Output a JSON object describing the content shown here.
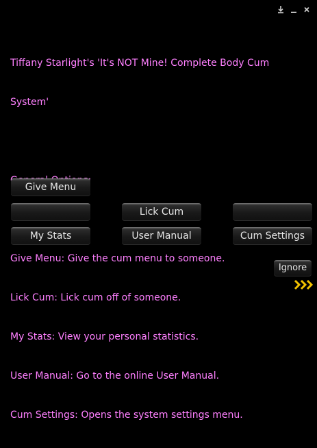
{
  "window": {
    "controls": {
      "download_icon": "⤓",
      "minimize_icon": "–",
      "close_icon": "×"
    }
  },
  "message": {
    "title_line1": "Tiffany Starlight's 'It's NOT Mine! Complete Body Cum",
    "title_line2": "System'",
    "section_heading": "General Options:",
    "options": [
      "Give Menu: Give the cum menu to someone.",
      "Lick Cum: Lick cum off of someone.",
      "My Stats: View your personal statistics.",
      "User Manual: Go to the online User Manual.",
      "Cum Settings: Opens the system settings menu."
    ],
    "color": "#ff80ff"
  },
  "buttons": {
    "give_menu": "Give Menu",
    "blank_left": "",
    "lick_cum": "Lick Cum",
    "blank_right": "",
    "my_stats": "My Stats",
    "user_manual": "User Manual",
    "cum_settings": "Cum Settings",
    "ignore": "Ignore"
  },
  "colors": {
    "background": "#000000",
    "chevron": "#f2c200"
  }
}
